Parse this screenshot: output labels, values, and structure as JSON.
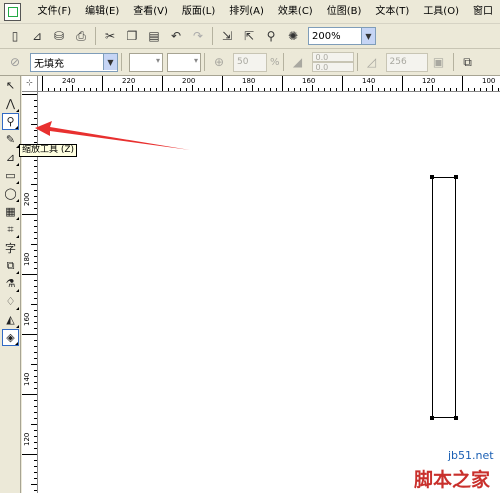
{
  "menubar": {
    "items": [
      "文件(F)",
      "编辑(E)",
      "查看(V)",
      "版面(L)",
      "排列(A)",
      "效果(C)",
      "位图(B)",
      "文本(T)",
      "工具(O)",
      "窗口"
    ]
  },
  "toolbar": {
    "zoom_value": "200%"
  },
  "property_bar": {
    "fill_value": "无填充",
    "transparency_value": "50",
    "transparency_unit": "%",
    "offset_value_1": "0.0",
    "offset_value_2": "0.0",
    "count_value": "256"
  },
  "tooltip": {
    "text": "缩放工具 (Z)"
  },
  "ruler_top": {
    "labels": [
      "240",
      "220",
      "200",
      "180",
      "160",
      "140",
      "120",
      "100"
    ]
  },
  "ruler_left": {
    "labels": [
      "200",
      "180",
      "160",
      "140",
      "120"
    ]
  },
  "watermark": {
    "url": "jb51.net",
    "name": "脚本之家"
  },
  "colors": {
    "arrow": "#e8302f",
    "tooltip_bg": "#ffffe1",
    "chrome": "#ece9d8"
  }
}
